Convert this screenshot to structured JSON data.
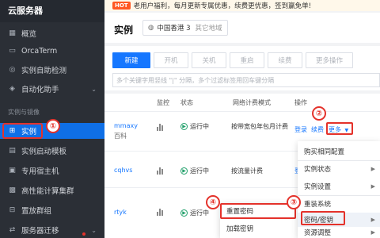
{
  "sidebar": {
    "brand": "云服务器",
    "items": [
      {
        "label": "概览",
        "icon": "grid-icon"
      },
      {
        "label": "OrcaTerm",
        "icon": "terminal-icon"
      },
      {
        "label": "实例自助检测",
        "icon": "check-icon"
      },
      {
        "label": "自动化助手",
        "icon": "robot-icon"
      },
      {
        "label": "实例",
        "icon": "instance-icon",
        "active": true
      },
      {
        "label": "实例启动模板",
        "icon": "template-icon"
      },
      {
        "label": "专用宿主机",
        "icon": "host-icon"
      },
      {
        "label": "高性能计算集群",
        "icon": "cluster-icon"
      },
      {
        "label": "置放群组",
        "icon": "group-icon"
      },
      {
        "label": "服务器迁移",
        "icon": "migrate-icon"
      }
    ],
    "section_label": "实例与镜像"
  },
  "promo": {
    "hot": "HOT",
    "text": "老用户福利，每月更新专属优惠，续费更优惠，签到赢免单!"
  },
  "header": {
    "title": "实例",
    "region": "中国香港 3",
    "other_region": "其它地域"
  },
  "toolbar": {
    "buttons": [
      "新建",
      "开机",
      "关机",
      "重启",
      "续费",
      "更多操作"
    ],
    "search_placeholder": "多个关键字用竖线 \"|\" 分隔，多个过滤标签用回车键分隔"
  },
  "table": {
    "headers": {
      "monitor": "监控",
      "status": "状态",
      "billing": "网络计费模式",
      "ops": "操作"
    },
    "rows": [
      {
        "name": "mmaxy",
        "name2": "百科",
        "status": "运行中",
        "billing": "按带宽包年包月计费",
        "op_login": "登录",
        "op_renew": "续费",
        "op_more": "更多"
      },
      {
        "name": "cqhvs",
        "status": "运行中",
        "billing": "按流量计费",
        "op_login": "登录"
      },
      {
        "name": "rtyk",
        "status": "运行中",
        "billing": "",
        "op_login": ""
      }
    ]
  },
  "more_menu": {
    "items": [
      {
        "label": "购买相同配置",
        "arrow": false
      },
      {
        "label": "实例状态",
        "arrow": true
      },
      {
        "label": "实例设置",
        "arrow": true
      },
      {
        "label": "重装系统",
        "arrow": false
      },
      {
        "label": "密码/密钥",
        "arrow": true
      },
      {
        "label": "资源调整",
        "arrow": true
      }
    ]
  },
  "sub_menu": {
    "items": [
      "重置密码",
      "加载密钥"
    ]
  },
  "badges": [
    "①",
    "②",
    "③",
    "④"
  ],
  "colors": {
    "accent": "#1677ff",
    "highlight": "#e4322b",
    "sidebar_bg": "#2b2f36"
  }
}
